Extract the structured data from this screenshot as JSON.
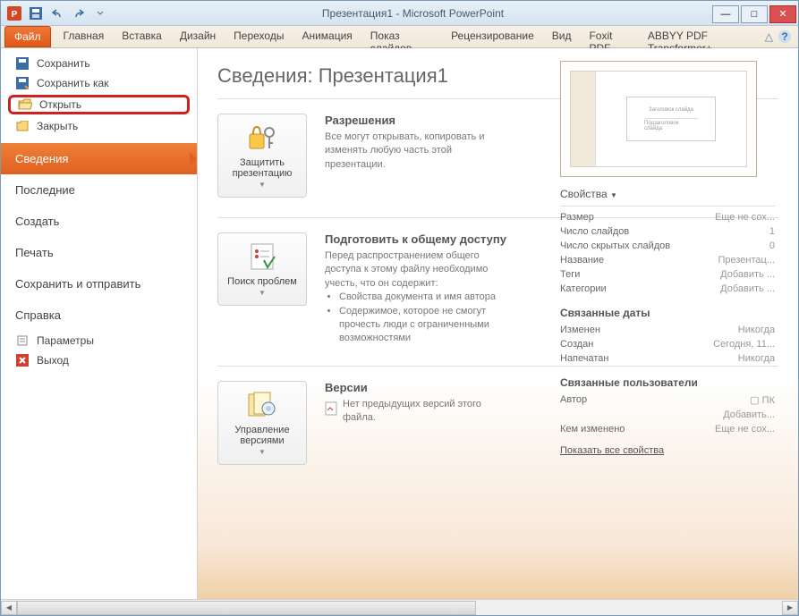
{
  "window": {
    "title": "Презентация1 - Microsoft PowerPoint"
  },
  "tabs": {
    "file": "Файл",
    "items": [
      "Главная",
      "Вставка",
      "Дизайн",
      "Переходы",
      "Анимация",
      "Показ слайдов",
      "Рецензирование",
      "Вид",
      "Foxit PDF",
      "ABBYY PDF Transformer+"
    ]
  },
  "sidebar": {
    "save": "Сохранить",
    "saveAs": "Сохранить как",
    "open": "Открыть",
    "close": "Закрыть",
    "info": "Сведения",
    "recent": "Последние",
    "new": "Создать",
    "print": "Печать",
    "saveSend": "Сохранить и отправить",
    "help": "Справка",
    "options": "Параметры",
    "exit": "Выход"
  },
  "info": {
    "heading": "Сведения: Презентация1",
    "protect_btn": "Защитить презентацию",
    "perm_title": "Разрешения",
    "perm_text": "Все могут открывать, копировать и изменять любую часть этой презентации.",
    "check_btn": "Поиск проблем",
    "prep_title": "Подготовить к общему доступу",
    "prep_text": "Перед распространением общего доступа к этому файлу необходимо учесть, что он содержит:",
    "prep_b1": "Свойства документа и имя автора",
    "prep_b2": "Содержимое, которое не смогут прочесть люди с ограниченными возможностями",
    "ver_btn": "Управление версиями",
    "ver_title": "Версии",
    "ver_text": "Нет предыдущих версий этого файла."
  },
  "thumb": {
    "title": "Заголовок слайда",
    "sub": "Подзаголовок слайда"
  },
  "props": {
    "head": "Свойства",
    "rows": [
      {
        "k": "Размер",
        "v": "Еще не сох..."
      },
      {
        "k": "Число слайдов",
        "v": "1"
      },
      {
        "k": "Число скрытых слайдов",
        "v": "0"
      },
      {
        "k": "Название",
        "v": "Презентац..."
      },
      {
        "k": "Теги",
        "v": "Добавить ..."
      },
      {
        "k": "Категории",
        "v": "Добавить ..."
      }
    ],
    "dates_head": "Связанные даты",
    "dates": [
      {
        "k": "Изменен",
        "v": "Никогда"
      },
      {
        "k": "Создан",
        "v": "Сегодня, 11..."
      },
      {
        "k": "Напечатан",
        "v": "Никогда"
      }
    ],
    "users_head": "Связанные пользователи",
    "author_k": "Автор",
    "author_v": "ПК",
    "add_author": "Добавить...",
    "changed_k": "Кем изменено",
    "changed_v": "Еще не сох...",
    "show_all": "Показать все свойства"
  }
}
